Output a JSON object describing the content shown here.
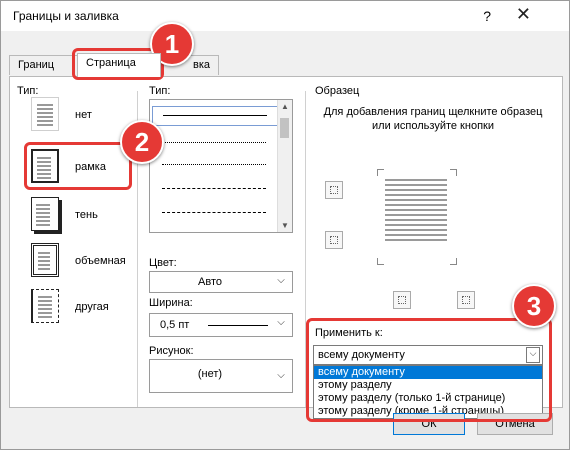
{
  "window": {
    "title": "Границы и заливка",
    "help": "?",
    "close": "✕"
  },
  "tabs": [
    {
      "label": "Границ"
    },
    {
      "label": "Страница"
    },
    {
      "label": "вка"
    }
  ],
  "type_section": {
    "label": "Тип:",
    "settings": [
      {
        "label": "нет"
      },
      {
        "label": "рамка"
      },
      {
        "label": "тень"
      },
      {
        "label": "объемная"
      },
      {
        "label": "другая"
      }
    ]
  },
  "style_section": {
    "label": "Тип:",
    "color_label": "Цвет:",
    "color_value": "Авто",
    "width_label": "Ширина:",
    "width_value": "0,5 пт",
    "art_label": "Рисунок:",
    "art_value": "(нет)"
  },
  "preview": {
    "label": "Образец",
    "instruction": "Для добавления границ щелкните образец или используйте кнопки"
  },
  "apply": {
    "label": "Применить к:",
    "value": "всему документу",
    "options": [
      "всему документу",
      "этому разделу",
      "этому разделу (только 1-й странице)",
      "этому разделу (кроме 1-й страницы)"
    ]
  },
  "buttons": {
    "ok": "ОК",
    "cancel": "Отмена"
  },
  "badges": [
    "1",
    "2",
    "3"
  ],
  "colors": {
    "highlight": "#e53935",
    "selection": "#0078d7"
  }
}
